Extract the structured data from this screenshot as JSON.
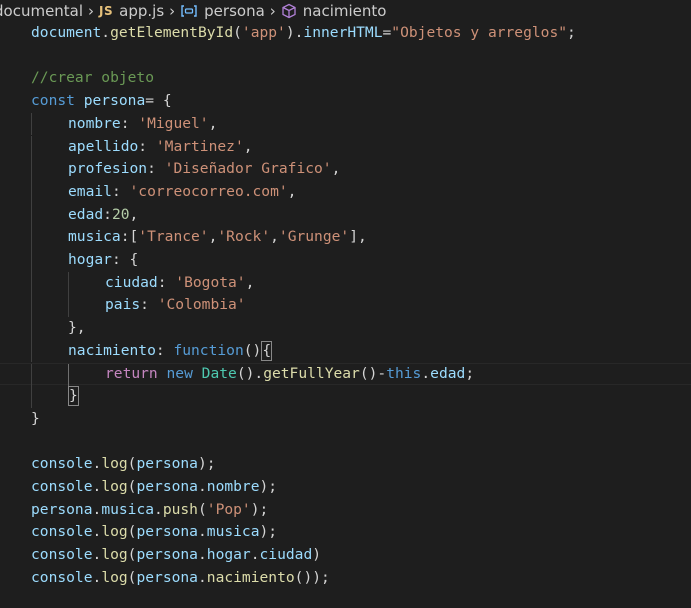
{
  "breadcrumb": {
    "folder": "documental",
    "file": "app.js",
    "file_icon": "JS",
    "variable": "persona",
    "method": "nacimiento"
  },
  "code": {
    "l1": {
      "a": "document",
      "b": ".",
      "c": "getElementById",
      "d": "(",
      "e": "'app'",
      "f": ").",
      "g": "innerHTML",
      "h": "=",
      "i": "\"Objetos y arreglos\"",
      "j": ";"
    },
    "l3": {
      "a": "//crear objeto"
    },
    "l4": {
      "a": "const",
      "b": " ",
      "c": "persona",
      "d": "= {"
    },
    "l5": {
      "a": "nombre",
      "b": ": ",
      "c": "'Miguel'",
      "d": ","
    },
    "l6": {
      "a": "apellido",
      "b": ": ",
      "c": "'Martinez'",
      "d": ","
    },
    "l7": {
      "a": "profesion",
      "b": ": ",
      "c": "'Diseñador Grafico'",
      "d": ","
    },
    "l8": {
      "a": "email",
      "b": ": ",
      "c": "'correocorreo.com'",
      "d": ","
    },
    "l9": {
      "a": "edad",
      "b": ":",
      "c": "20",
      "d": ","
    },
    "l10": {
      "a": "musica",
      "b": ":[",
      "c": "'Trance'",
      "d": ",",
      "e": "'Rock'",
      "f": ",",
      "g": "'Grunge'",
      "h": "],"
    },
    "l11": {
      "a": "hogar",
      "b": ": {"
    },
    "l12": {
      "a": "ciudad",
      "b": ": ",
      "c": "'Bogota'",
      "d": ","
    },
    "l13": {
      "a": "pais",
      "b": ": ",
      "c": "'Colombia'"
    },
    "l14": {
      "a": "},"
    },
    "l15": {
      "a": "nacimiento",
      "b": ": ",
      "c": "function",
      "d": "()",
      "e": "{"
    },
    "l16": {
      "a": "return",
      "b": " ",
      "c": "new",
      "d": " ",
      "e": "Date",
      "f": "().",
      "g": "getFullYear",
      "h": "()-",
      "i": "this",
      "j": ".",
      "k": "edad",
      "l": ";"
    },
    "l17": {
      "a": "}"
    },
    "l18": {
      "a": "}"
    },
    "l20": {
      "a": "console",
      "b": ".",
      "c": "log",
      "d": "(",
      "e": "persona",
      "f": ");"
    },
    "l21": {
      "a": "console",
      "b": ".",
      "c": "log",
      "d": "(",
      "e": "persona",
      "f": ".",
      "g": "nombre",
      "h": ");"
    },
    "l22": {
      "a": "persona",
      "b": ".",
      "c": "musica",
      "d": ".",
      "e": "push",
      "f": "(",
      "g": "'Pop'",
      "h": ");"
    },
    "l23": {
      "a": "console",
      "b": ".",
      "c": "log",
      "d": "(",
      "e": "persona",
      "f": ".",
      "g": "musica",
      "h": ");"
    },
    "l24": {
      "a": "console",
      "b": ".",
      "c": "log",
      "d": "(",
      "e": "persona",
      "f": ".",
      "g": "hogar",
      "h": ".",
      "i": "ciudad",
      "j": ")"
    },
    "l25": {
      "a": "console",
      "b": ".",
      "c": "log",
      "d": "(",
      "e": "persona",
      "f": ".",
      "g": "nacimiento",
      "h": "());"
    }
  },
  "colors": {
    "background": "#1e1e1e",
    "variable": "#9cdcfe",
    "function": "#dcdcaa",
    "string": "#ce9178",
    "number": "#b5cea8",
    "keyword": "#569cd6",
    "control": "#c586c0",
    "class": "#4ec9b0",
    "comment": "#6a9955"
  }
}
